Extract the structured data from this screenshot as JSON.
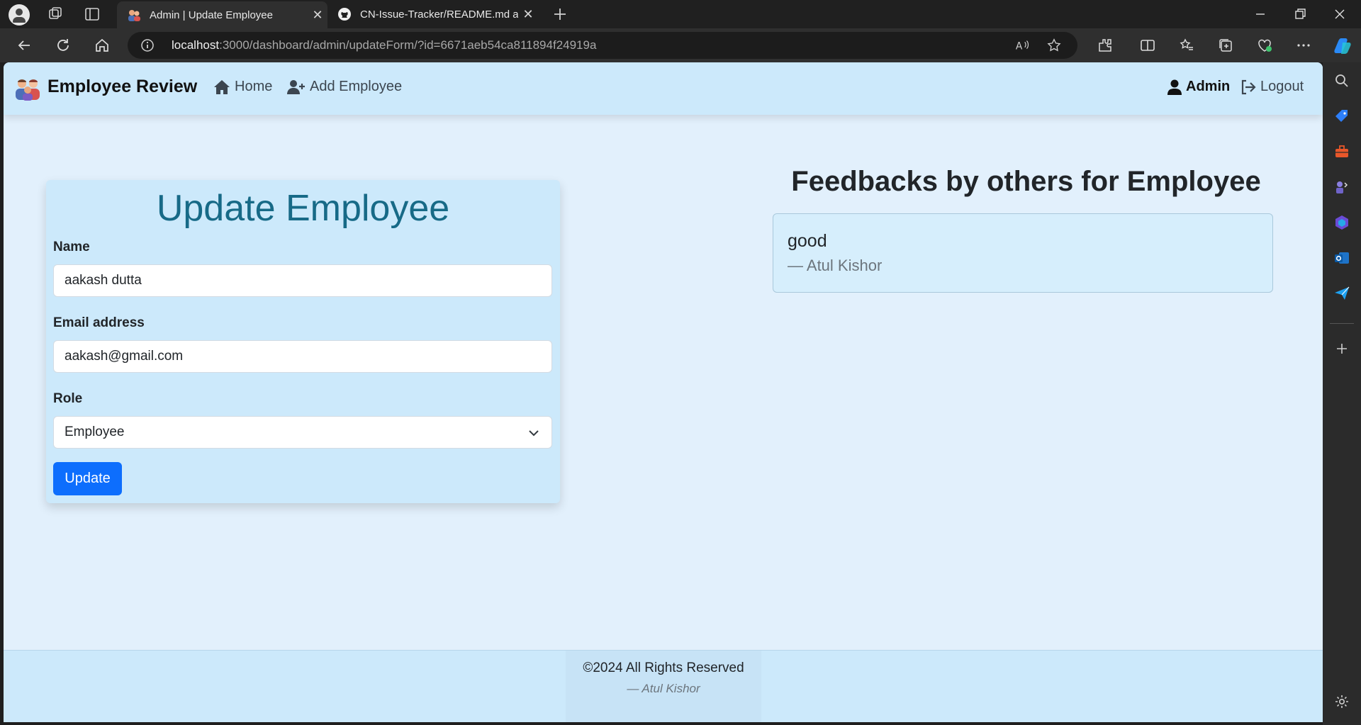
{
  "browser": {
    "tabs": [
      {
        "title": "Admin | Update Employee",
        "active": true,
        "favicon": "people-icon"
      },
      {
        "title": "CN-Issue-Tracker/README.md at",
        "active": false,
        "favicon": "github-icon"
      }
    ],
    "url_host": "localhost",
    "url_rest": ":3000/dashboard/admin/updateForm/?id=6671aeb54ca811894f24919a"
  },
  "navbar": {
    "brand": "Employee Review",
    "links": [
      {
        "label": "Home",
        "icon": "home-icon"
      },
      {
        "label": "Add Employee",
        "icon": "user-plus-icon"
      }
    ],
    "user_label": "Admin",
    "logout_label": "Logout"
  },
  "form": {
    "title": "Update Employee",
    "name_label": "Name",
    "name_value": "aakash dutta",
    "email_label": "Email address",
    "email_value": "aakash@gmail.com",
    "role_label": "Role",
    "role_value": "Employee",
    "submit_label": "Update"
  },
  "feedbacks": {
    "heading": "Feedbacks by others for Employee",
    "items": [
      {
        "text": "good",
        "author": "— Atul Kishor"
      }
    ]
  },
  "footer": {
    "copyright": "©2024 All Rights Reserved",
    "author": "— Atul Kishor"
  },
  "colors": {
    "accent": "#0d6efd",
    "navbar_bg": "#cce9fb",
    "page_bg": "#e2f0fc",
    "title_color": "#176a87"
  }
}
